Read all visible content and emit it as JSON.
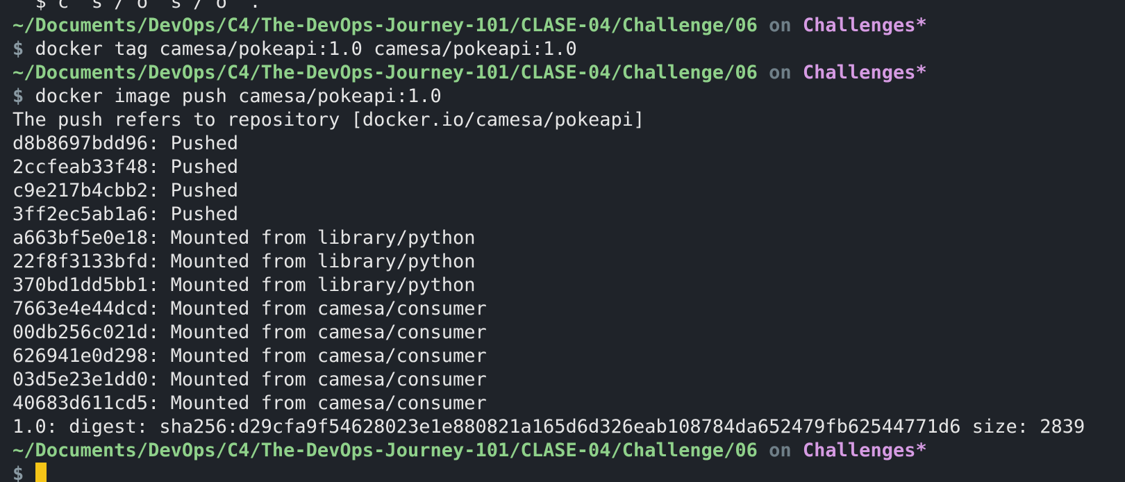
{
  "colors": {
    "background": "#1f2329",
    "path": "#8fd18a",
    "branch": "#d69be3",
    "on": "#6f7f88",
    "dollar": "#8a9aa3",
    "cursor": "#f5c518"
  },
  "partial_top": "  $ c  s / o  s / o  .",
  "prompt": {
    "path": "~/Documents/DevOps/C4/The-DevOps-Journey-101/CLASE-04/Challenge/06",
    "on": "on",
    "branch": "Challenges*",
    "symbol": "$"
  },
  "commands": [
    "docker tag camesa/pokeapi:1.0 camesa/pokeapi:1.0",
    "docker image push camesa/pokeapi:1.0"
  ],
  "output": [
    "The push refers to repository [docker.io/camesa/pokeapi]",
    "d8b8697bdd96: Pushed",
    "2ccfeab33f48: Pushed",
    "c9e217b4cbb2: Pushed",
    "3ff2ec5ab1a6: Pushed",
    "a663bf5e0e18: Mounted from library/python",
    "22f8f3133bfd: Mounted from library/python",
    "370bd1dd5bb1: Mounted from library/python",
    "7663e4e44dcd: Mounted from camesa/consumer",
    "00db256c021d: Mounted from camesa/consumer",
    "626941e0d298: Mounted from camesa/consumer",
    "03d5e23e1dd0: Mounted from camesa/consumer",
    "40683d611cd5: Mounted from camesa/consumer",
    "1.0: digest: sha256:d29cfa9f54628023e1e880821a165d6d326eab108784da652479fb62544771d6 size: 2839"
  ]
}
